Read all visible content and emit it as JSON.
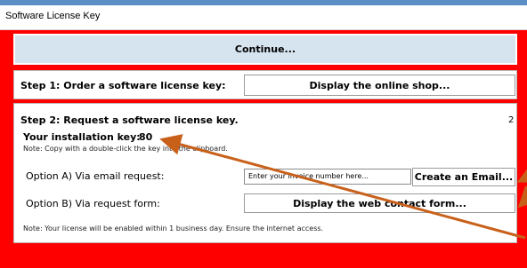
{
  "window": {
    "title": "Software License Key"
  },
  "continue_button": "Continue...",
  "step1": {
    "heading": "Step 1: Order a software license key:",
    "button": "Display the online shop..."
  },
  "step2": {
    "heading": "Step 2: Request a software license key.",
    "counter": "2",
    "install_key_label": "Your installation key:",
    "install_key_value": "80",
    "note_copy": "Note: Copy with a double-click the key into the clipboard.",
    "option_a_label": "Option A) Via email request:",
    "invoice_input_value": "Enter your invoice number here...",
    "email_button": "Create an Email...",
    "option_b_label": "Option B) Via request form:",
    "web_form_button": "Display the web contact form...",
    "note_enable": "Note: Your license will be enabled within 1 business day. Ensure the internet access."
  },
  "colors": {
    "background": "#ff0000",
    "continue_bg": "#d6e4f0",
    "arrow": "#c8601a"
  }
}
